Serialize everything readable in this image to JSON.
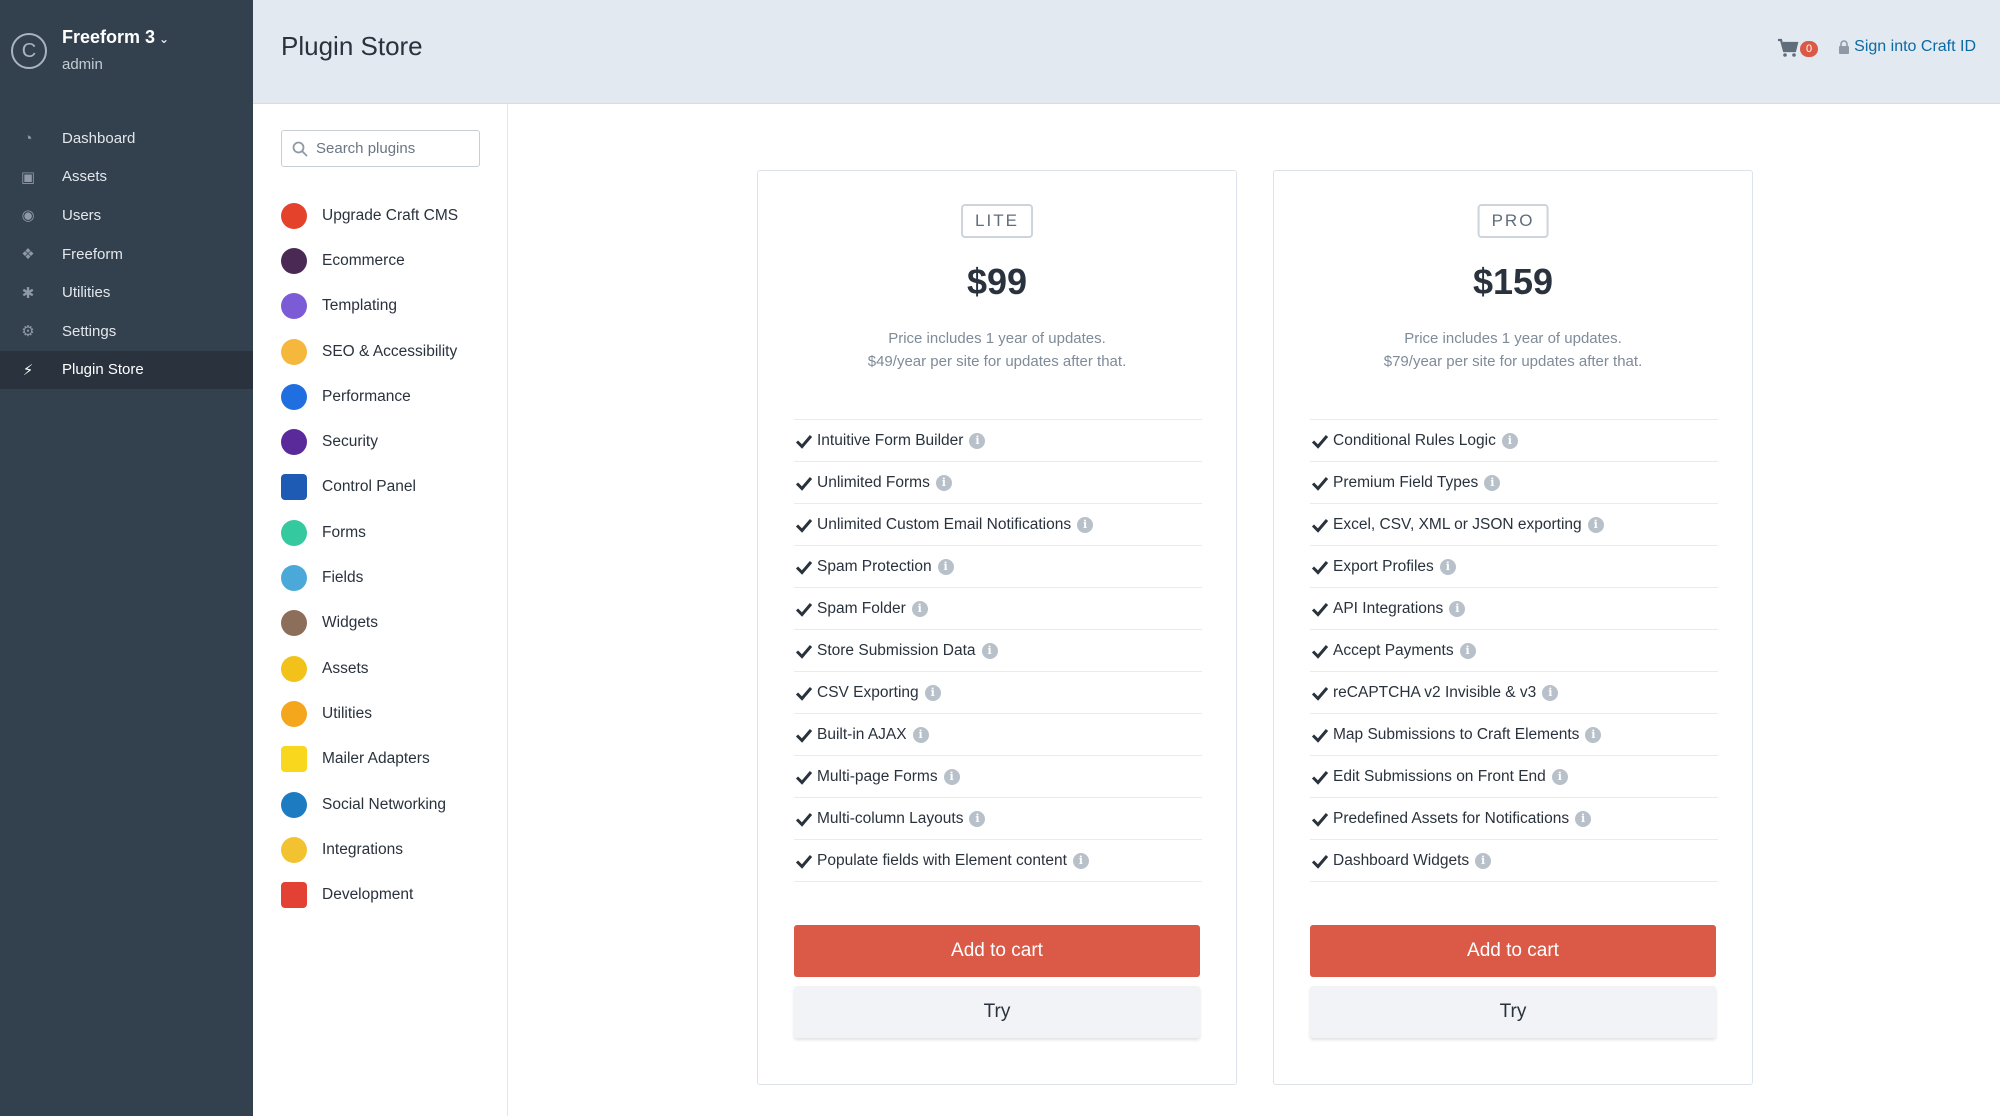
{
  "site": {
    "name": "Freeform 3",
    "user": "admin",
    "logo_letter": "C"
  },
  "nav": [
    {
      "label": "Dashboard",
      "icon": "dashboard-icon"
    },
    {
      "label": "Assets",
      "icon": "image-icon"
    },
    {
      "label": "Users",
      "icon": "users-icon"
    },
    {
      "label": "Freeform",
      "icon": "freeform-icon"
    },
    {
      "label": "Utilities",
      "icon": "wrench-icon"
    },
    {
      "label": "Settings",
      "icon": "gear-icon"
    },
    {
      "label": "Plugin Store",
      "icon": "plug-icon",
      "active": true
    }
  ],
  "header": {
    "title": "Plugin Store",
    "cart_count": "0",
    "signin_label": "Sign into Craft ID"
  },
  "search": {
    "placeholder": "Search plugins"
  },
  "categories": [
    {
      "label": "Upgrade Craft CMS",
      "color": "#e5422b"
    },
    {
      "label": "Ecommerce",
      "color": "#4a2a55"
    },
    {
      "label": "Templating",
      "color": "#7b5cd6"
    },
    {
      "label": "SEO & Accessibility",
      "color": "#f5b83c"
    },
    {
      "label": "Performance",
      "color": "#1f6fe0"
    },
    {
      "label": "Security",
      "color": "#5a2a9a"
    },
    {
      "label": "Control Panel",
      "color": "#1e5bb5"
    },
    {
      "label": "Forms",
      "color": "#35c9a0"
    },
    {
      "label": "Fields",
      "color": "#4aa9d9"
    },
    {
      "label": "Widgets",
      "color": "#8d6e5b"
    },
    {
      "label": "Assets",
      "color": "#f2c21b"
    },
    {
      "label": "Utilities",
      "color": "#f4a61c"
    },
    {
      "label": "Mailer Adapters",
      "color": "#f8d71c"
    },
    {
      "label": "Social Networking",
      "color": "#1d7bc2"
    },
    {
      "label": "Integrations",
      "color": "#f2c230"
    },
    {
      "label": "Development",
      "color": "#e34133"
    }
  ],
  "editions": {
    "lite": {
      "name": "LITE",
      "price": "$99",
      "note1": "Price includes 1 year of updates.",
      "note2": "$49/year per site for updates after that.",
      "features": [
        "Intuitive Form Builder",
        "Unlimited Forms",
        "Unlimited Custom Email Notifications",
        "Spam Protection",
        "Spam Folder",
        "Store Submission Data",
        "CSV Exporting",
        "Built-in AJAX",
        "Multi-page Forms",
        "Multi-column Layouts",
        "Populate fields with Element content"
      ],
      "add_to_cart": "Add to cart",
      "try": "Try"
    },
    "pro": {
      "name": "PRO",
      "price": "$159",
      "note1": "Price includes 1 year of updates.",
      "note2": "$79/year per site for updates after that.",
      "features": [
        "Conditional Rules Logic",
        "Premium Field Types",
        "Excel, CSV, XML or JSON exporting",
        "Export Profiles",
        "API Integrations",
        "Accept Payments",
        "reCAPTCHA v2 Invisible & v3",
        "Map Submissions to Craft Elements",
        "Edit Submissions on Front End",
        "Predefined Assets for Notifications",
        "Dashboard Widgets"
      ],
      "add_to_cart": "Add to cart",
      "try": "Try"
    }
  },
  "colors": {
    "accent": "#da5a47",
    "link": "#0b69a3",
    "sidebar": "#33404d",
    "header": "#e3e9f0"
  }
}
